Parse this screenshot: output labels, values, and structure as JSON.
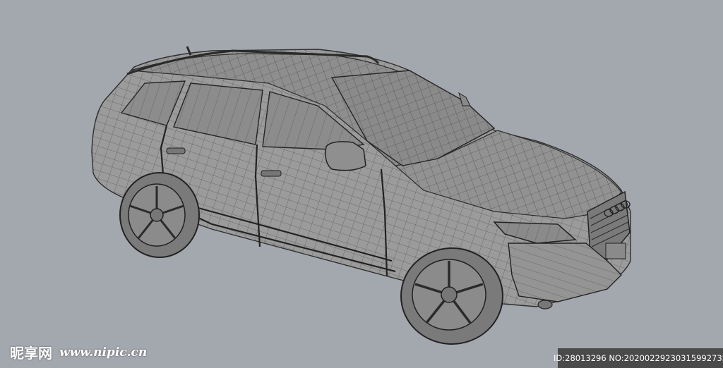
{
  "image": {
    "subject": "car-3d-wireframe-render",
    "colors": {
      "background": "#a3a7ae",
      "body": "#9a9a9a",
      "wire": "#3a3a3a",
      "glass": "#8a8a8a",
      "tire": "#777777"
    }
  },
  "watermark": {
    "brand": "昵享网",
    "url": "www.nipic.cn"
  },
  "id_bar": {
    "text": "ID:28013296 NO:20200229230315992735"
  }
}
